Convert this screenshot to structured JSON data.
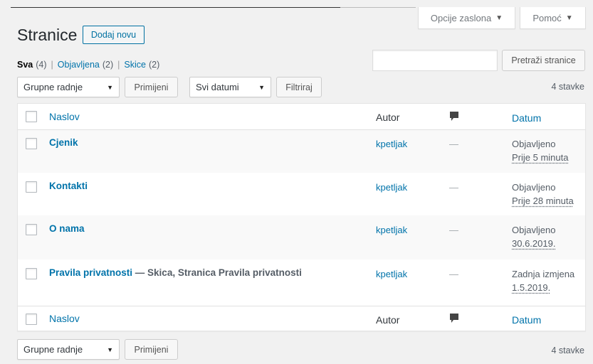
{
  "screen_meta": {
    "options_label": "Opcije zaslona",
    "help_label": "Pomoć",
    "caret": "▼"
  },
  "header": {
    "title": "Stranice",
    "add_new_label": "Dodaj novu"
  },
  "filters": {
    "all_label": "Sva",
    "all_count": "(4)",
    "published_label": "Objavljena",
    "published_count": "(2)",
    "drafts_label": "Skice",
    "drafts_count": "(2)",
    "separator": "|"
  },
  "search": {
    "value": "",
    "button_label": "Pretraži stranice"
  },
  "top_nav": {
    "bulk_select": "Grupne radnje",
    "apply_label": "Primijeni",
    "date_select": "Svi datumi",
    "filter_label": "Filtriraj",
    "items_count": "4 stavke",
    "select_arrow": "▼"
  },
  "bottom_nav": {
    "bulk_select": "Grupne radnje",
    "apply_label": "Primijeni",
    "items_count": "4 stavke"
  },
  "table": {
    "columns": {
      "title": "Naslov",
      "author": "Autor",
      "comments_icon": "comment-bubble-icon",
      "date": "Datum"
    },
    "rows": [
      {
        "title": "Cjenik",
        "state": "",
        "author": "kpetljak",
        "comments": "—",
        "date_status": "Objavljeno",
        "date_value": "Prije 5 minuta"
      },
      {
        "title": "Kontakti",
        "state": "",
        "author": "kpetljak",
        "comments": "—",
        "date_status": "Objavljeno",
        "date_value": "Prije 28 minuta"
      },
      {
        "title": "O nama",
        "state": "",
        "author": "kpetljak",
        "comments": "—",
        "date_status": "Objavljeno",
        "date_value": "30.6.2019."
      },
      {
        "title": "Pravila privatnosti",
        "state": " — Skica, Stranica Pravila privatnosti",
        "author": "kpetljak",
        "comments": "—",
        "date_status": "Zadnja izmjena",
        "date_value": "1.5.2019."
      }
    ]
  },
  "colors": {
    "link": "#0073aa",
    "background": "#f1f1f1",
    "alt_row": "#f9f9f9"
  }
}
